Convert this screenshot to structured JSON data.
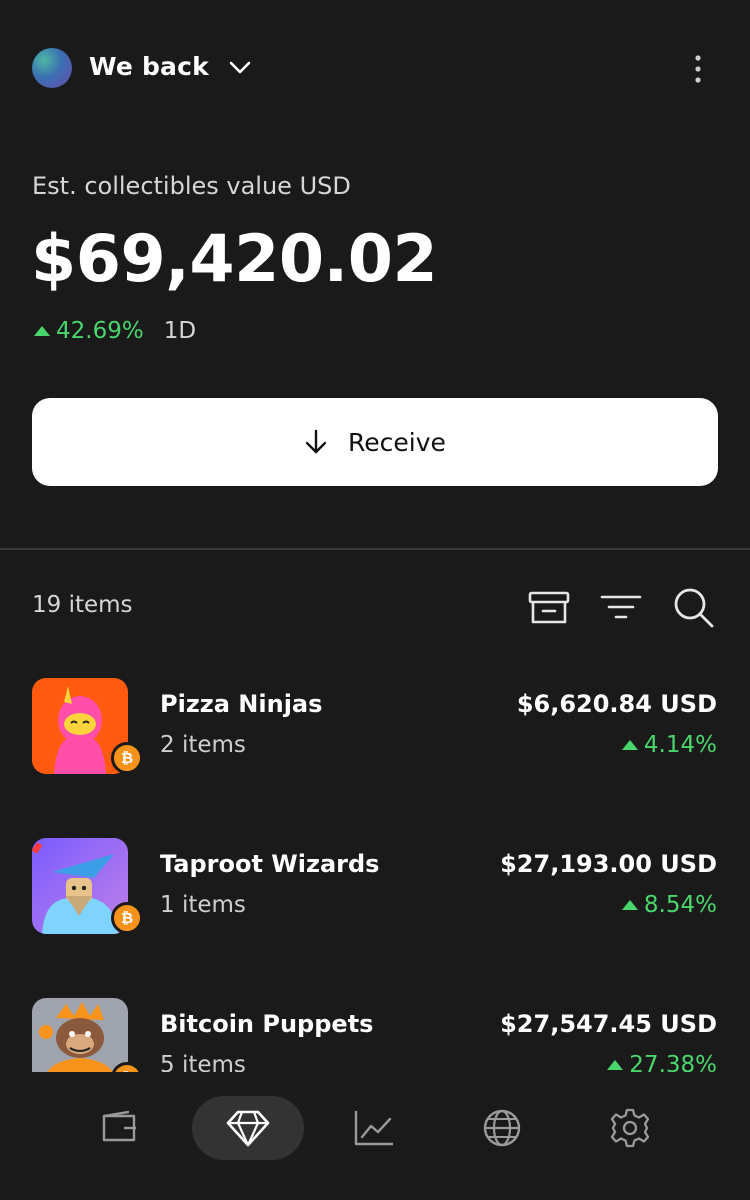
{
  "header": {
    "account_name": "We back",
    "avatar_icon": "gradient-avatar",
    "menu_icon": "more-vertical-icon"
  },
  "summary": {
    "label": "Est. collectibles value USD",
    "balance": "$69,420.02",
    "change": "42.69%",
    "period": "1D"
  },
  "receive": {
    "label": "Receive",
    "icon": "arrow-down-icon"
  },
  "list_header": {
    "count": "19 items",
    "icons": [
      "archive-icon",
      "filter-icon",
      "search-icon"
    ]
  },
  "collections": [
    {
      "name": "Pizza Ninjas",
      "count": "2 items",
      "value": "$6,620.84 USD",
      "change": "4.14%"
    },
    {
      "name": "Taproot Wizards",
      "count": "1 items",
      "value": "$27,193.00 USD",
      "change": "8.54%"
    },
    {
      "name": "Bitcoin Puppets",
      "count": "5 items",
      "value": "$27,547.45 USD",
      "change": "27.38%"
    }
  ],
  "nav": {
    "items": [
      "wallet-icon",
      "diamond-icon",
      "chart-icon",
      "globe-icon",
      "settings-icon"
    ],
    "active": "diamond-icon"
  },
  "colors": {
    "background": "#1a1a1a",
    "positive": "#4ad66d",
    "bitcoin": "#f7931a",
    "button": "#ffffff"
  }
}
